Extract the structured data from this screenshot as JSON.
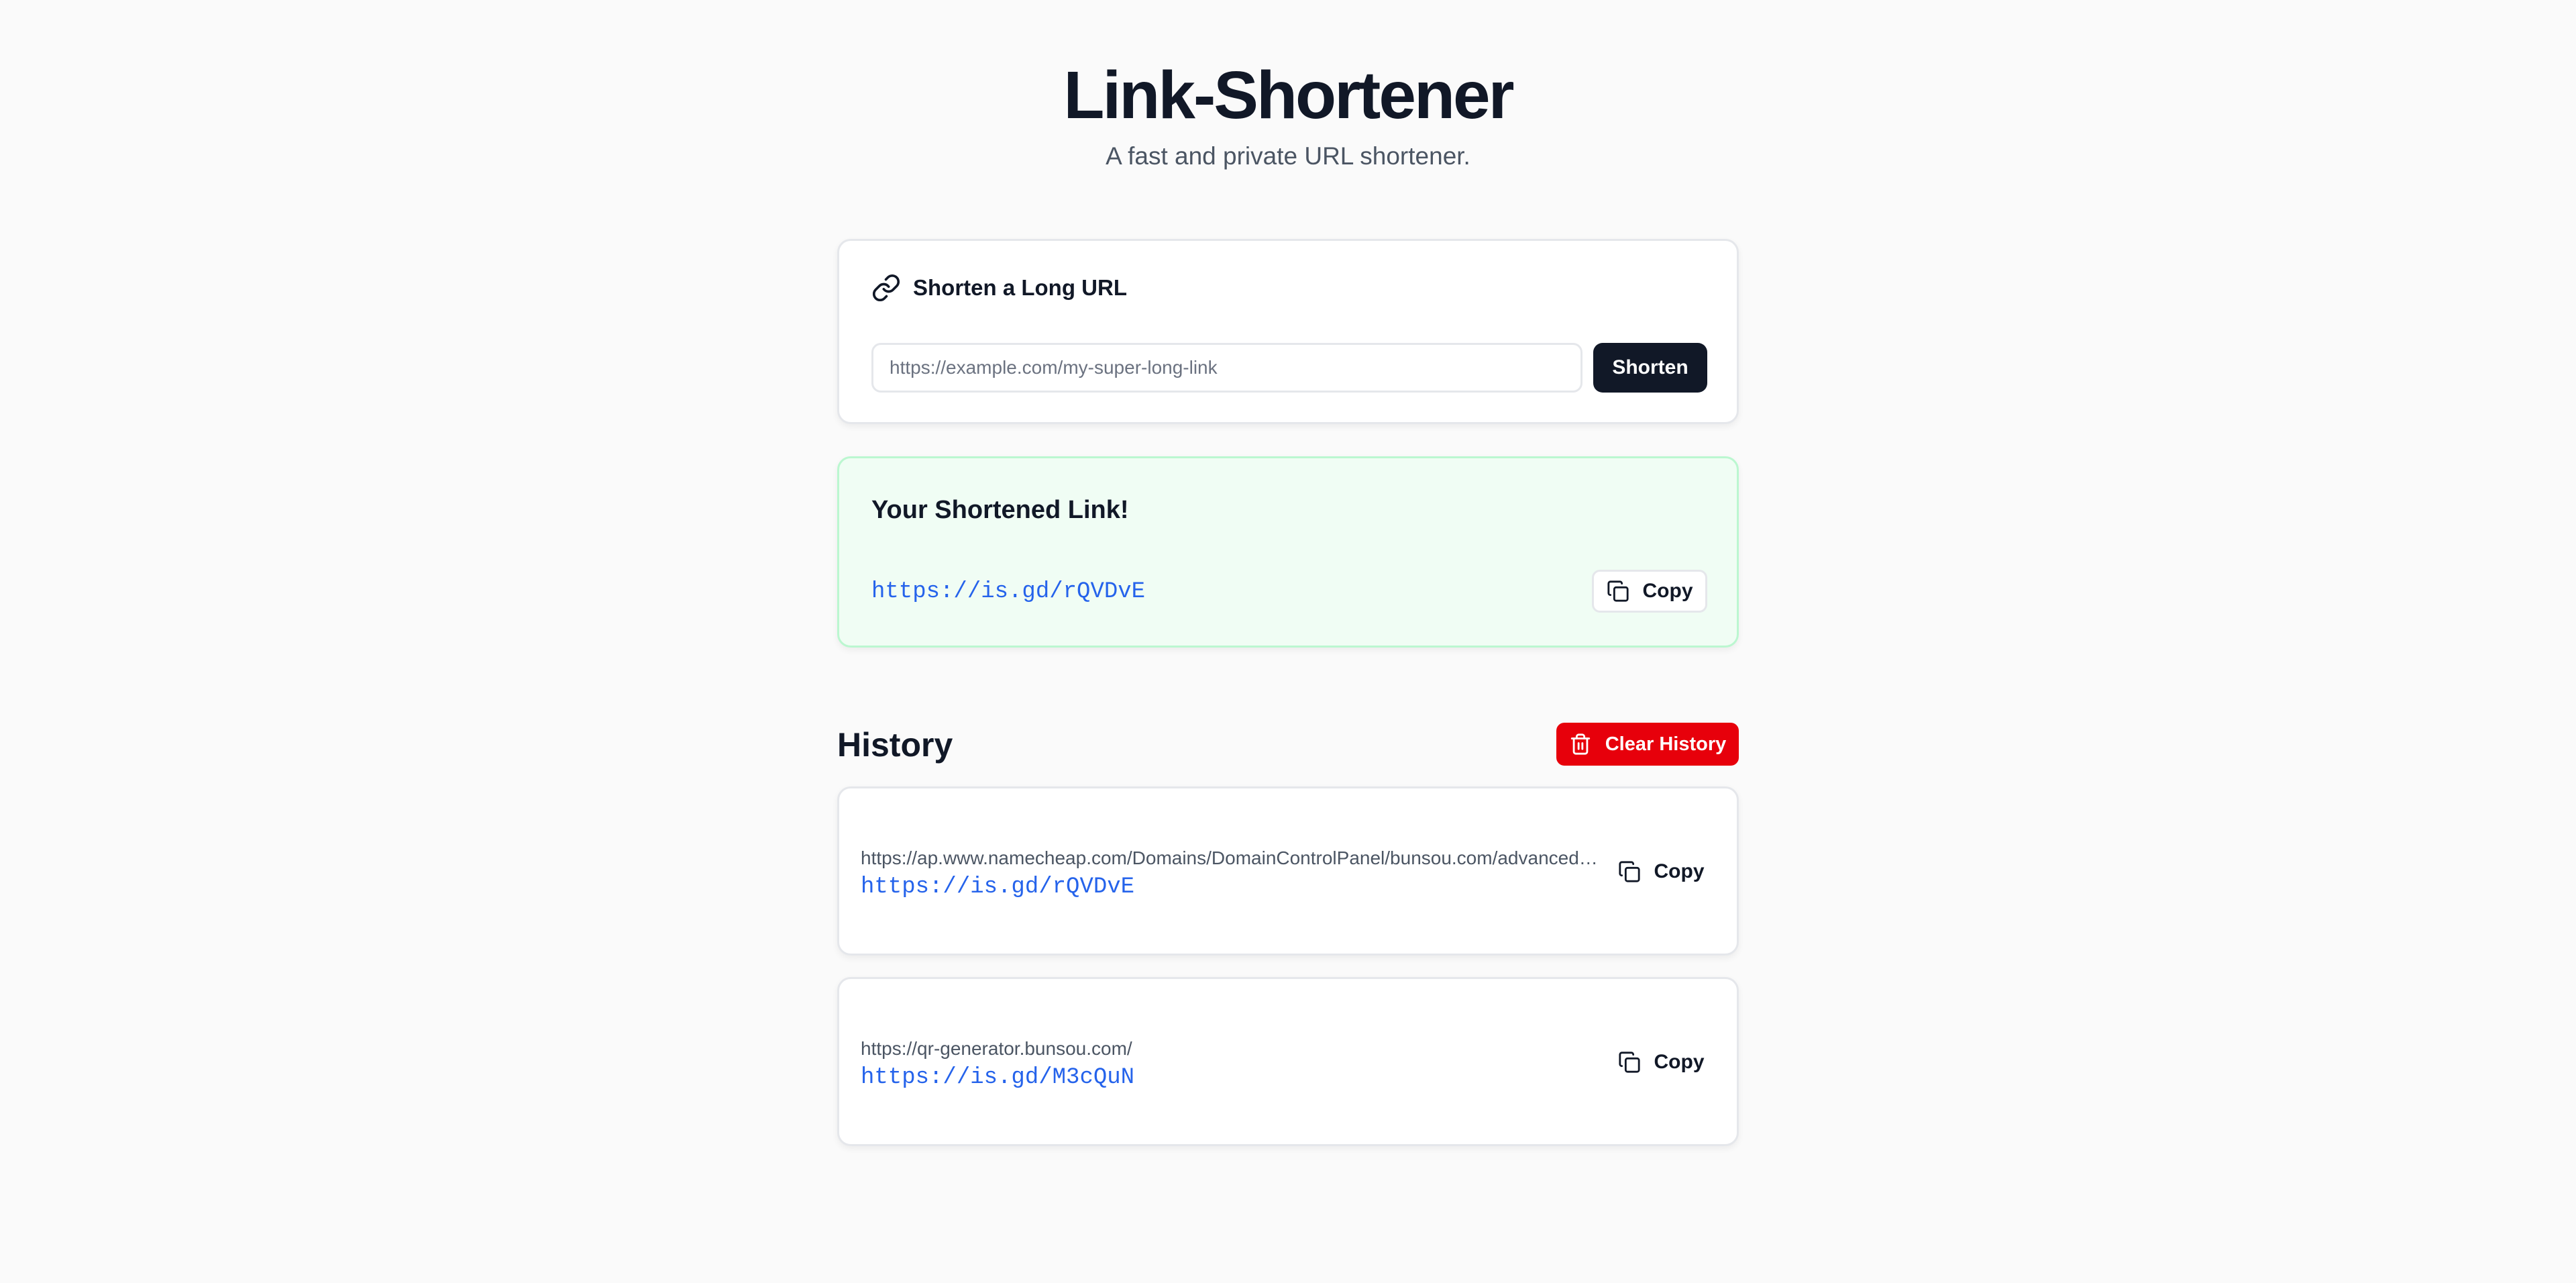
{
  "header": {
    "title": "Link-Shortener",
    "subtitle": "A fast and private URL shortener."
  },
  "shorten_form": {
    "icon": "link-icon",
    "heading": "Shorten a Long URL",
    "input_value": "",
    "input_placeholder": "https://example.com/my-super-long-link",
    "button_label": "Shorten"
  },
  "result": {
    "heading": "Your Shortened Link!",
    "short_url": "https://is.gd/rQVDvE",
    "copy_label": "Copy",
    "copy_icon": "copy-icon"
  },
  "history": {
    "heading": "History",
    "clear_label": "Clear History",
    "clear_icon": "trash-icon",
    "items": [
      {
        "original": "https://ap.www.namecheap.com/Domains/DomainControlPanel/bunsou.com/advanced-dns",
        "short": "https://is.gd/rQVDvE",
        "copy_label": "Copy"
      },
      {
        "original": "https://qr-generator.bunsou.com/",
        "short": "https://is.gd/M3cQuN",
        "copy_label": "Copy"
      }
    ]
  },
  "colors": {
    "background": "#fafafa",
    "primary_button": "#111827",
    "danger_button": "#e7000b",
    "link": "#2563eb",
    "success_bg": "#f0fdf4",
    "success_border": "#bbf7d0"
  }
}
